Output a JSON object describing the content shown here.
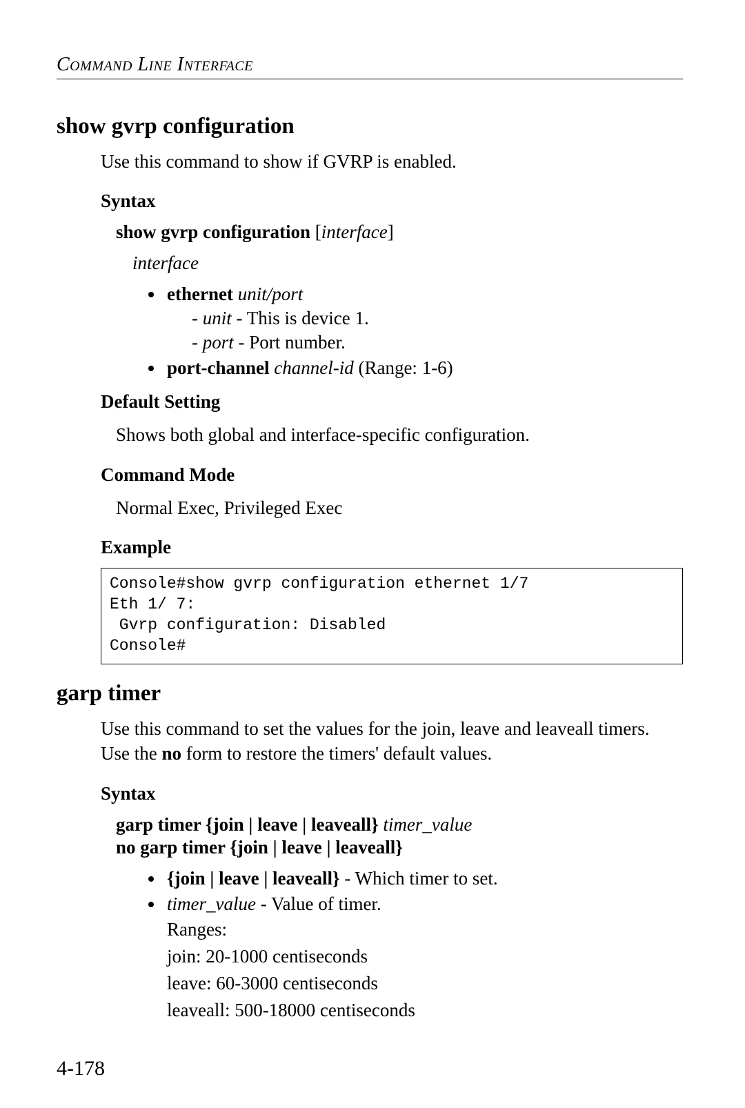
{
  "runningHead": "Command Line Interface",
  "pageNumber": "4-178",
  "sections": [
    {
      "title": "show gvrp configuration",
      "intro": "Use this command to show if GVRP is enabled.",
      "syntaxHeading": "Syntax",
      "syntax": {
        "cmd_bold": "show gvrp configuration",
        "cmd_rest_open": " [",
        "cmd_param": "interface",
        "cmd_rest_close": "]",
        "paramLabel": "interface",
        "bullets": {
          "ethernet_bold": "ethernet",
          "ethernet_ital": " unit/port",
          "dash_unit_ital": "unit",
          "dash_unit_rest": " - This is device 1.",
          "dash_port_ital": "port",
          "dash_port_rest": " - Port number.",
          "portchannel_bold": "port-channel",
          "portchannel_ital": " channel-id",
          "portchannel_rest": " (Range: 1-6)"
        }
      },
      "defaultHeading": "Default Setting",
      "defaultText": "Shows both global and interface-specific configuration.",
      "modeHeading": "Command Mode",
      "modeText": "Normal Exec, Privileged Exec",
      "exampleHeading": "Example",
      "exampleCode": "Console#show gvrp configuration ethernet 1/7\nEth 1/ 7:\n Gvrp configuration: Disabled\nConsole#"
    },
    {
      "title": "garp timer",
      "intro_pre": "Use this command to set the values for the join, leave and leaveall timers. Use the ",
      "intro_bold": "no",
      "intro_post": " form to restore the timers' default values.",
      "syntaxHeading": "Syntax",
      "syntax": {
        "line1_bold1": "garp timer",
        "line1_bold2": " {join | leave | leaveall}",
        "line1_ital": " timer_value",
        "line2_bold": "no garp timer {join | leave | leaveall}",
        "bullets": {
          "b1_bold": "{join | leave | leaveall}",
          "b1_rest": " - Which timer to set.",
          "b2_ital": "timer_value",
          "b2_rest": " - Value of timer.",
          "ranges_label": "Ranges:",
          "range_join": "join: 20-1000 centiseconds",
          "range_leave": "leave: 60-3000 centiseconds",
          "range_leaveall": "leaveall: 500-18000 centiseconds"
        }
      }
    }
  ]
}
